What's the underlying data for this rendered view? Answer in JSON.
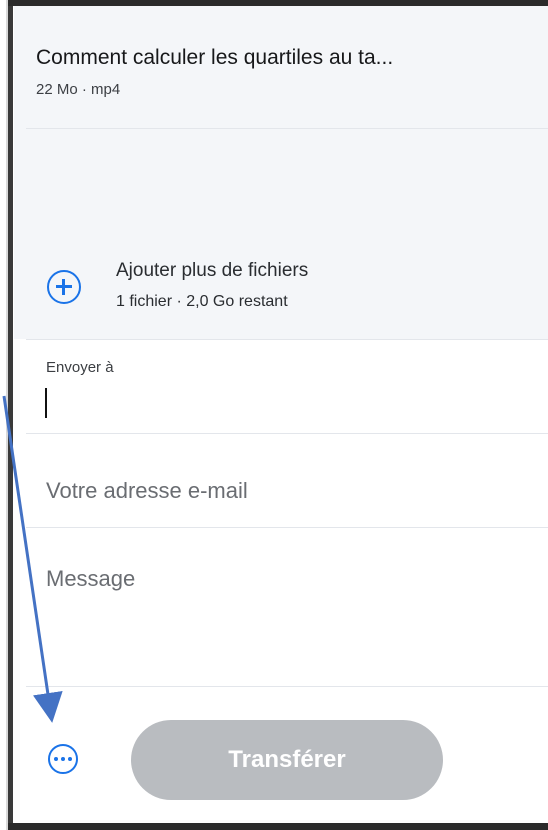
{
  "file": {
    "name": "Comment calculer les quartiles au ta...",
    "meta": "22 Mo · mp4"
  },
  "add_files": {
    "title": "Ajouter plus de fichiers",
    "meta": "1 fichier · 2,0 Go restant"
  },
  "form": {
    "send_to_label": "Envoyer à",
    "send_to_value": "",
    "email_placeholder": "Votre adresse e-mail",
    "message_placeholder": "Message"
  },
  "actions": {
    "transfer_label": "Transférer"
  },
  "icons": {
    "add": "plus-circle-icon",
    "more": "more-options-icon"
  },
  "colors": {
    "accent": "#1a73e8",
    "button_disabled": "#b9bcc0",
    "annotation_arrow": "#4472c4"
  }
}
